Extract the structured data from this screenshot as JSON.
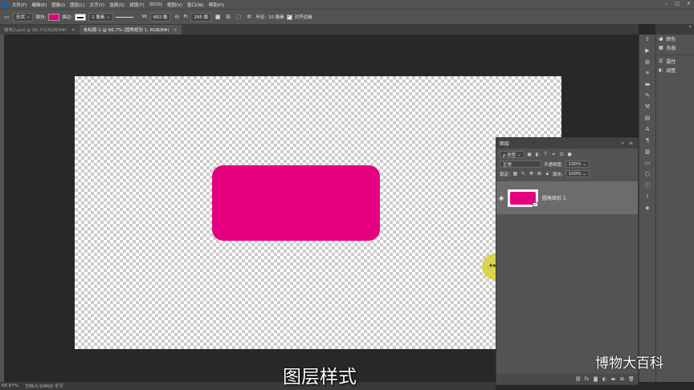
{
  "colors": {
    "shape_fill": "#e4007f",
    "cursor_highlight": "#d6ce28"
  },
  "menubar": {
    "items": [
      "文件(F)",
      "编辑(E)",
      "图像(I)",
      "图层(L)",
      "文字(Y)",
      "选择(S)",
      "滤镜(T)",
      "3D(D)",
      "视图(V)",
      "窗口(W)",
      "帮助(H)"
    ],
    "window_controls": [
      "–",
      "□",
      "✕"
    ]
  },
  "options": {
    "mode": "形状",
    "fill_label": "填充:",
    "stroke_label": "描边:",
    "stroke_width": "1 像素",
    "w_label": "W:",
    "w_value": "663 像",
    "h_label": "H:",
    "h_value": "295 像",
    "radius_label": "半径:",
    "radius_value": "10 像素",
    "align_edges_label": "对齐边缘"
  },
  "tabs": [
    {
      "label": "猫咪2.psd @ 66.7%(RGB/8#)",
      "close": "×"
    },
    {
      "label": "未标题-1 @ 66.7% (圆角矩形 1, RGB/8#)",
      "close": "×"
    }
  ],
  "layers_panel": {
    "title": "图层",
    "header_icons": "» ≡",
    "kind_filter": "ρ 类型",
    "blend_mode": "正常",
    "opacity_label": "不透明度:",
    "opacity_value": "100%",
    "lock_label": "锁定:",
    "fill_label": "填充:",
    "fill_value": "100%",
    "layer_name": "圆角矩形 1"
  },
  "dock_panels": {
    "entries": [
      "颜色",
      "色板",
      "属性",
      "调整"
    ]
  },
  "status": {
    "zoom": "66.67%",
    "doc_info": "文档:5.93M/0 字节"
  },
  "overlay": {
    "caption": "图层样式",
    "watermark": "博物大百科"
  }
}
